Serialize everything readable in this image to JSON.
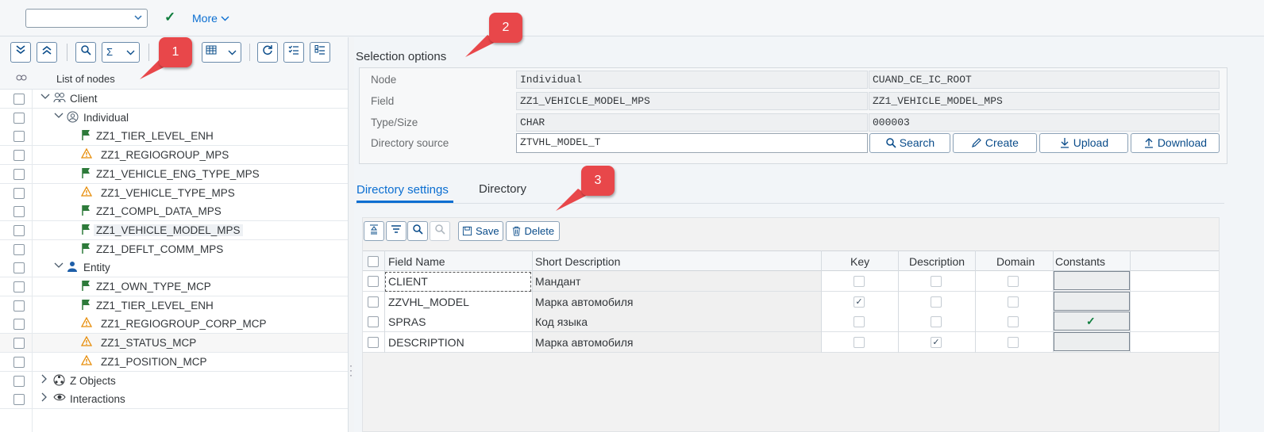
{
  "toolbar_top": {
    "select_value": "",
    "more_label": "More"
  },
  "left_toolbar": {
    "icons": [
      "expand-all-icon",
      "collapse-all-icon",
      "search-icon",
      "sum-icon",
      "layout-icon",
      "refresh-icon",
      "select-all-icon",
      "deselect-all-icon"
    ],
    "sum_glyph": "Σ"
  },
  "tree": {
    "header": "List of nodes",
    "nodes": [
      {
        "label": "Client",
        "level": 1,
        "icon": "group-icon",
        "expanded": true
      },
      {
        "label": "Individual",
        "level": 2,
        "icon": "person-circle-icon",
        "expanded": true
      },
      {
        "label": "ZZ1_TIER_LEVEL_ENH",
        "level": 3,
        "icon": "flag-icon"
      },
      {
        "label": "ZZ1_REGIOGROUP_MPS",
        "level": 3,
        "icon": "warning-icon"
      },
      {
        "label": "ZZ1_VEHICLE_ENG_TYPE_MPS",
        "level": 3,
        "icon": "flag-icon"
      },
      {
        "label": "ZZ1_VEHICLE_TYPE_MPS",
        "level": 3,
        "icon": "warning-icon"
      },
      {
        "label": "ZZ1_COMPL_DATA_MPS",
        "level": 3,
        "icon": "flag-icon"
      },
      {
        "label": "ZZ1_VEHICLE_MODEL_MPS",
        "level": 3,
        "icon": "flag-icon",
        "selected": true
      },
      {
        "label": "ZZ1_DEFLT_COMM_MPS",
        "level": 3,
        "icon": "flag-icon"
      },
      {
        "label": "Entity",
        "level": 2,
        "icon": "person-icon",
        "expanded": true
      },
      {
        "label": "ZZ1_OWN_TYPE_MCP",
        "level": 3,
        "icon": "flag-icon"
      },
      {
        "label": "ZZ1_TIER_LEVEL_ENH",
        "level": 3,
        "icon": "flag-icon"
      },
      {
        "label": "ZZ1_REGIOGROUP_CORP_MCP",
        "level": 3,
        "icon": "warning-icon"
      },
      {
        "label": "ZZ1_STATUS_MCP",
        "level": 3,
        "icon": "warning-icon"
      },
      {
        "label": "ZZ1_POSITION_MCP",
        "level": 3,
        "icon": "warning-icon"
      },
      {
        "label": "Z Objects",
        "level": 1,
        "icon": "network-icon",
        "expanded": false
      },
      {
        "label": "Interactions",
        "level": 1,
        "icon": "eye-icon",
        "expanded": false
      }
    ]
  },
  "callouts": [
    "1",
    "2",
    "3"
  ],
  "selection": {
    "title": "Selection options",
    "node_label": "Node",
    "node_value": "Individual",
    "node_value2": "CUAND_CE_IC_ROOT",
    "field_label": "Field",
    "field_value": "ZZ1_VEHICLE_MODEL_MPS",
    "field_value2": "ZZ1_VEHICLE_MODEL_MPS",
    "type_label": "Type/Size",
    "type_value": "CHAR",
    "type_value2": "000003",
    "dir_label": "Directory source",
    "dir_value": "ZTVHL_MODEL_T",
    "buttons": {
      "search": "Search",
      "create": "Create",
      "upload": "Upload",
      "download": "Download"
    }
  },
  "tabs": {
    "settings": "Directory settings",
    "directory": "Directory"
  },
  "grid_toolbar": {
    "save": "Save",
    "delete": "Delete"
  },
  "grid": {
    "columns": [
      "Field Name",
      "Short Description",
      "Key",
      "Description",
      "Domain",
      "Constants"
    ],
    "rows": [
      {
        "field": "CLIENT",
        "desc": "Мандант",
        "key": false,
        "description": false,
        "domain": false,
        "constants": false
      },
      {
        "field": "ZZVHL_MODEL",
        "desc": "Марка автомобиля",
        "key": true,
        "description": false,
        "domain": false,
        "constants": false
      },
      {
        "field": "SPRAS",
        "desc": "Код языка",
        "key": false,
        "description": false,
        "domain": false,
        "constants": true
      },
      {
        "field": "DESCRIPTION",
        "desc": "Марка автомобиля",
        "key": false,
        "description": true,
        "domain": false,
        "constants": false
      }
    ]
  },
  "colors": {
    "accent": "#0a6ed1",
    "callout": "#e8474a",
    "flag": "#2d7a3a",
    "warning": "#e78c07",
    "success": "#107e3e"
  }
}
